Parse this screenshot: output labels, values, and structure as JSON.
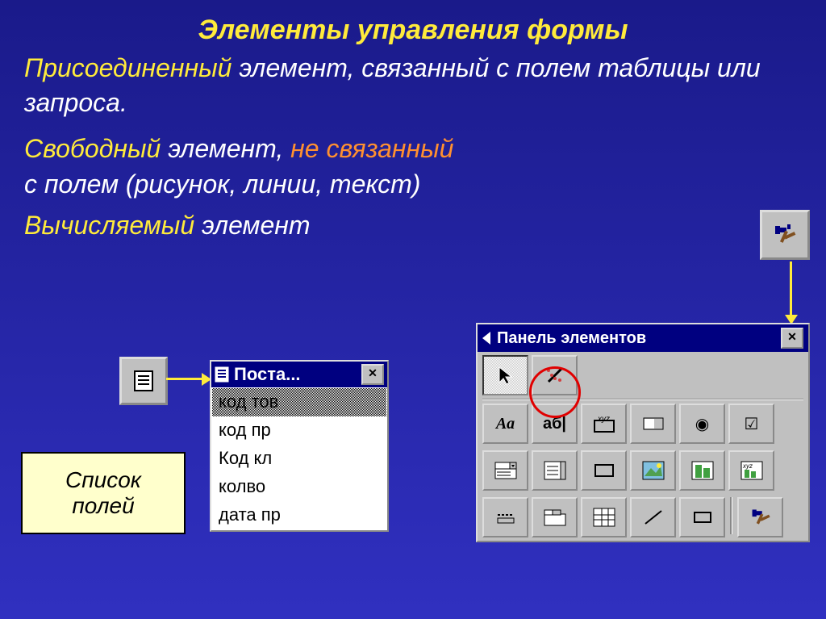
{
  "title": "Элементы управления формы",
  "lines": {
    "l1_yel": "Присоединенный",
    "l1_rest": " элемент, связанный с полем таблицы или запроса.",
    "l2_yel": "Свободный",
    "l2_w1": " элемент, ",
    "l2_orange": "не связанный",
    "l3": "с полем  (рисунок, линии, текст)",
    "l4": "Вычисляемый ",
    "l4_rest": "элемент"
  },
  "fields_label_l1": "Список",
  "fields_label_l2": "полей",
  "fieldlist": {
    "title": "Поста...",
    "items": [
      "код тов",
      "код пр",
      "Код кл",
      "колво",
      "дата пр"
    ]
  },
  "toolbox_title": "Панель элементов",
  "close": "✕",
  "icons": {
    "hammer": "hammer-icon",
    "doclines": "document-lines-icon",
    "pointer": "pointer-icon",
    "wizard": "wizard-wand-icon",
    "label": "Aa",
    "textbox": "аб|",
    "group": "xyz",
    "toggle": "toggle-icon",
    "option": "◉",
    "check": "☑",
    "combo": "combo-icon",
    "list": "list-icon",
    "cmdbtn": "button-icon",
    "image": "image-icon",
    "unbound": "unbound-object-icon",
    "bound": "bound-object-icon",
    "pagebreak": "pagebreak-icon",
    "tab": "tab-icon",
    "subform": "subform-icon",
    "line": "line-icon",
    "rect": "rect-icon",
    "more": "more-tools-icon"
  }
}
